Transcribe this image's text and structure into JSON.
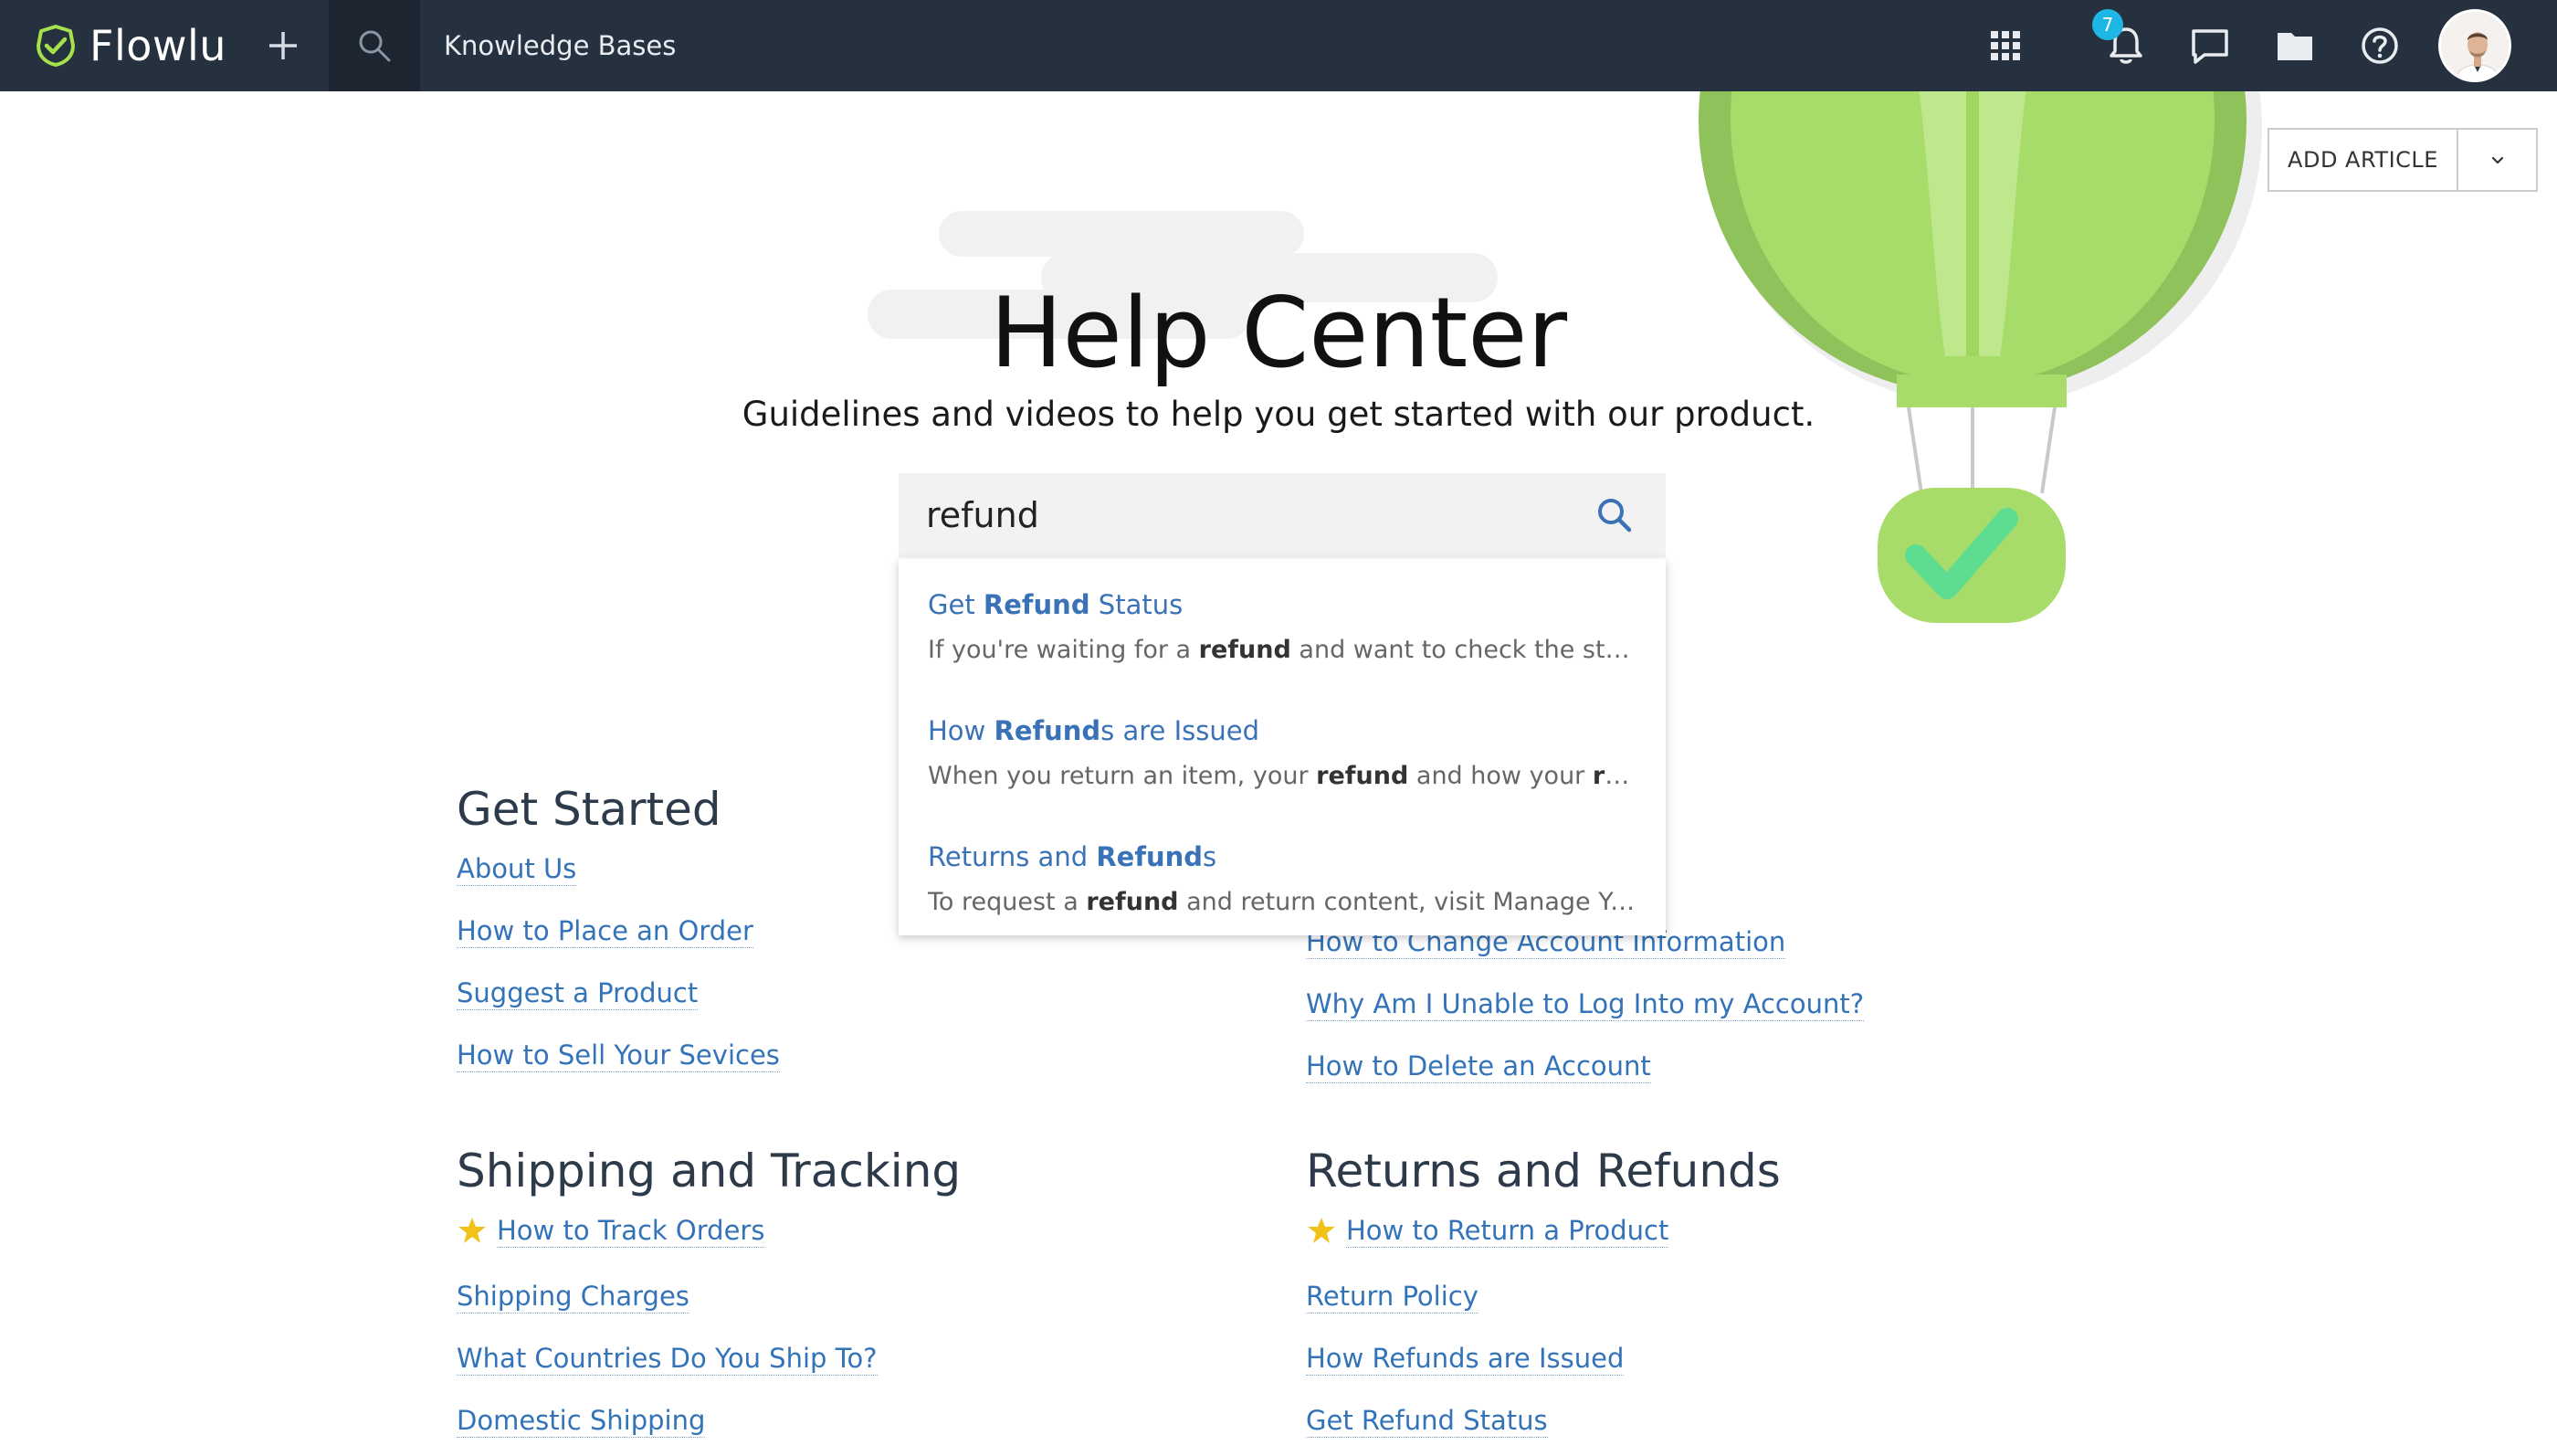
{
  "app": {
    "name": "Flowlu",
    "breadcrumb": "Knowledge Bases",
    "notifications_count": "7"
  },
  "toolbar": {
    "add_article_label": "ADD ARTICLE"
  },
  "hero": {
    "title": "Help Center",
    "subtitle": "Guidelines and videos to help you get started with our product."
  },
  "search": {
    "value": "refund",
    "suggestions": [
      {
        "title_html": "Get <b>Refund</b> Status",
        "snippet_html": "If you're waiting for a <b>refund</b> and want to check the status, you can view the status of your refund in Your Orders."
      },
      {
        "title_html": "How <b>Refund</b>s are Issued",
        "snippet_html": "When you return an item, your <b>refund</b> and how your <b>refund</b> is issued depends on how you paid."
      },
      {
        "title_html": "Returns and <b>Refund</b>s",
        "snippet_html": "To request a <b>refund</b> and return content, visit Manage Your Account settings."
      }
    ]
  },
  "categories": [
    {
      "title": "Get Started",
      "articles": [
        {
          "label": "About Us"
        },
        {
          "label": "How to Place an Order"
        },
        {
          "label": "Suggest a Product"
        },
        {
          "label": "How to Sell Your Sevices"
        }
      ]
    },
    {
      "title": "",
      "articles": [
        {
          "label": "How to Change Account Information"
        },
        {
          "label": "Why Am I Unable to Log Into my Account?"
        },
        {
          "label": "How to Delete an Account"
        }
      ]
    },
    {
      "title": "Shipping and Tracking",
      "articles": [
        {
          "label": "How to Track Orders",
          "starred": true
        },
        {
          "label": "Shipping Charges"
        },
        {
          "label": "What Countries Do You Ship To?"
        },
        {
          "label": "Domestic Shipping"
        }
      ]
    },
    {
      "title": "Returns and Refunds",
      "articles": [
        {
          "label": "How to Return a Product",
          "starred": true
        },
        {
          "label": "Return Policy"
        },
        {
          "label": "How Refunds are Issued"
        },
        {
          "label": "Get Refund Status"
        }
      ]
    }
  ],
  "colors": {
    "topbar": "#26313f",
    "accent_green": "#a8dc6a",
    "link_blue": "#3373b9",
    "badge": "#1eb6e4",
    "star": "#f2c21b"
  },
  "icons": [
    "flowlu-logo-icon",
    "plus-icon",
    "search-icon",
    "apps-grid-icon",
    "bell-icon",
    "chat-icon",
    "folder-icon",
    "help-icon",
    "chevron-down-icon",
    "star-icon"
  ]
}
